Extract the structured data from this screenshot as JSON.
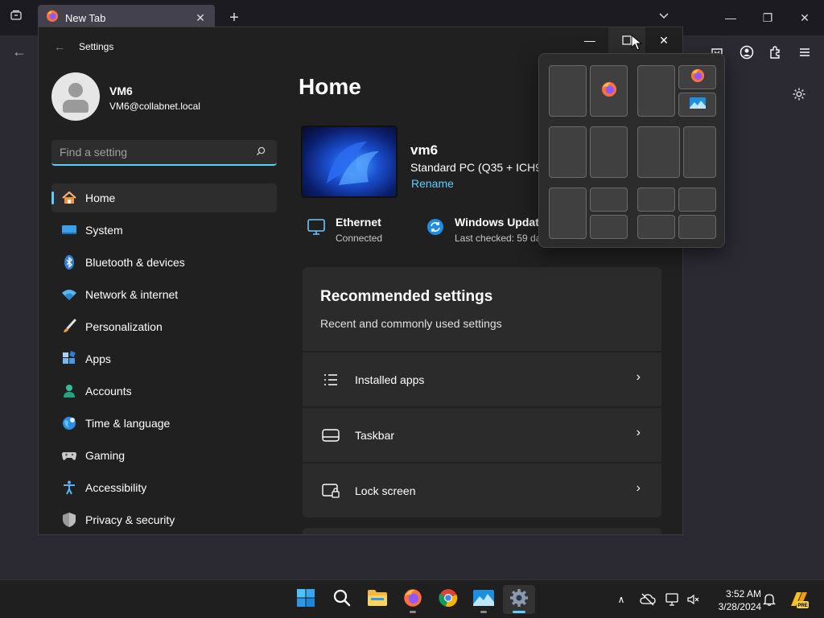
{
  "browser": {
    "tab_title": "New Tab",
    "tab_close": "✕",
    "new_tab": "+",
    "min": "—",
    "restore": "❐",
    "close": "✕"
  },
  "settings": {
    "app_title": "Settings",
    "back": "←",
    "min": "—",
    "close": "✕",
    "profile": {
      "name": "VM6",
      "email": "VM6@collabnet.local"
    },
    "search_placeholder": "Find a setting",
    "nav": [
      {
        "label": "Home",
        "icon": "home-icon"
      },
      {
        "label": "System",
        "icon": "monitor-icon"
      },
      {
        "label": "Bluetooth & devices",
        "icon": "bluetooth-icon"
      },
      {
        "label": "Network & internet",
        "icon": "wifi-icon"
      },
      {
        "label": "Personalization",
        "icon": "brush-icon"
      },
      {
        "label": "Apps",
        "icon": "apps-icon"
      },
      {
        "label": "Accounts",
        "icon": "person-icon"
      },
      {
        "label": "Time & language",
        "icon": "globe-icon"
      },
      {
        "label": "Gaming",
        "icon": "gamepad-icon"
      },
      {
        "label": "Accessibility",
        "icon": "accessibility-icon"
      },
      {
        "label": "Privacy & security",
        "icon": "shield-icon"
      }
    ],
    "page_title": "Home",
    "device": {
      "name": "vm6",
      "model": "Standard PC (Q35 + ICH9,",
      "rename": "Rename"
    },
    "status": [
      {
        "title": "Ethernet",
        "sub": "Connected",
        "icon": "ethernet-icon"
      },
      {
        "title": "Windows Update",
        "sub": "Last checked: 59 da",
        "icon": "windows-update-icon"
      }
    ],
    "recommended": {
      "title": "Recommended settings",
      "subtitle": "Recent and commonly used settings",
      "rows": [
        {
          "label": "Installed apps",
          "icon": "list-icon"
        },
        {
          "label": "Taskbar",
          "icon": "taskbar-icon"
        },
        {
          "label": "Lock screen",
          "icon": "lock-screen-icon"
        }
      ],
      "chevron": "›"
    }
  },
  "taskbar": {
    "apps": [
      "start",
      "search",
      "file-explorer",
      "firefox",
      "chrome",
      "photos",
      "settings"
    ],
    "active_app": "settings",
    "tray_expand": "∧",
    "time": "3:52 AM",
    "date": "3/28/2024",
    "pre_badge": "PRE"
  },
  "colors": {
    "accent": "#60cdff",
    "window_bg": "#202020",
    "card_bg": "#2b2b2b"
  }
}
